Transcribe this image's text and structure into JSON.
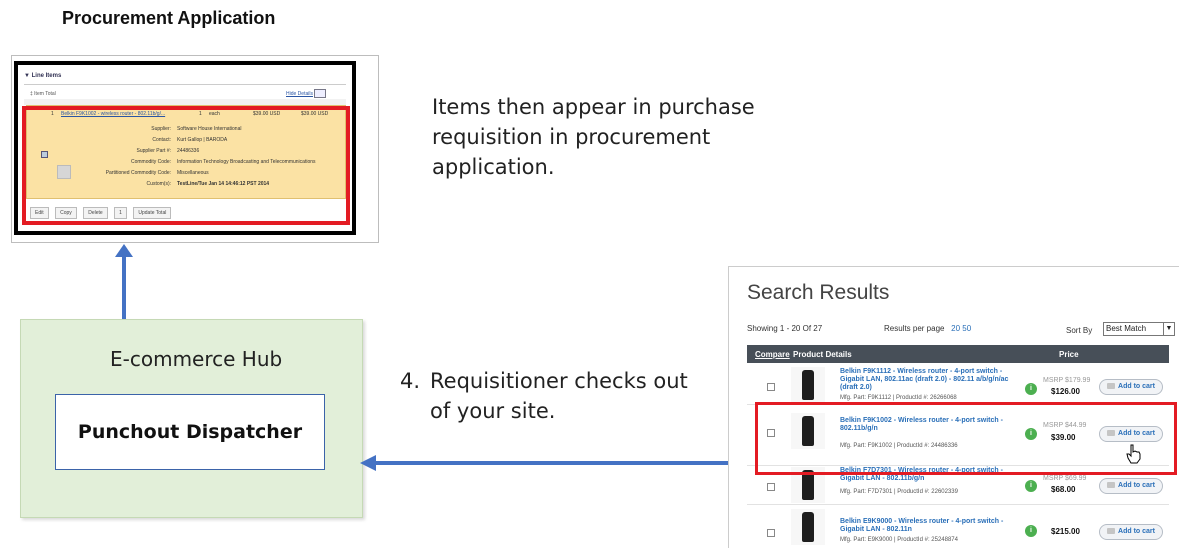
{
  "procurement": {
    "title": "Procurement Application",
    "panel_header": "▼ Line Items",
    "item_total": "‡ Item Total",
    "hide_details": "Hide Details",
    "line_number": "1",
    "product_link": "Belkin F9K1002 - wireless router - 802.11b/g/...",
    "qty": "1",
    "unit": "each",
    "unit_price": "$39.00 USD",
    "ext_price": "$39.00 USD",
    "details": [
      {
        "label": "Supplier:",
        "value": "Software House International"
      },
      {
        "label": "Contact:",
        "value": "Kurt Gallop | BARODA"
      },
      {
        "label": "Supplier Part #:",
        "value": "24486336"
      },
      {
        "label": "Commodity Code:",
        "value": "Information Technology Broadcasting and Telecommunications"
      },
      {
        "label": "Partitioned Commodity Code:",
        "value": "Miscellaneous"
      },
      {
        "label": "Custom(s):",
        "value": "TestLine/Tue Jan 14 14:46:12 PST 2014"
      }
    ],
    "buttons": [
      "Edit",
      "Copy",
      "Delete",
      "1",
      "Update Total"
    ]
  },
  "captions": {
    "step_items": "Items then appear in purchase requisition in procurement application.",
    "step4_num": "4.",
    "step4_line1": "Requisitioner checks out",
    "step4_line2": "of your site."
  },
  "hub": {
    "title": "E-commerce Hub",
    "dispatcher": "Punchout Dispatcher"
  },
  "search": {
    "title": "Search Results",
    "showing": "Showing 1 - 20 Of 27",
    "results_per_page_label": "Results per page",
    "per_page_options": "20 50",
    "sort_by_label": "Sort By",
    "sort_value": "Best Match",
    "col_compare": "Compare",
    "col_product": "Product Details",
    "col_price": "Price",
    "add_to_cart": "Add to cart",
    "rows": [
      {
        "name": "Belkin F9K1112 - Wireless router - 4-port switch - Gigabit LAN, 802.11ac (draft 2.0) - 802.11 a/b/g/n/ac (draft 2.0)",
        "mfg": "Mfg. Part: F9K1112 | ProductId #: 26266068",
        "msrp": "MSRP $179.99",
        "price": "$126.00"
      },
      {
        "name": "Belkin F9K1002 - Wireless router - 4-port switch - 802.11b/g/n",
        "mfg": "Mfg. Part: F9K1002 | ProductId #: 24486336",
        "msrp": "MSRP $44.99",
        "price": "$39.00"
      },
      {
        "name": "Belkin F7D7301 - Wireless router - 4-port switch - Gigabit LAN - 802.11b/g/n",
        "mfg": "Mfg. Part: F7D7301 | ProductId #: 22602339",
        "msrp": "MSRP $69.99",
        "price": "$68.00"
      },
      {
        "name": "Belkin E9K9000 - Wireless router - 4-port switch - Gigabit LAN - 802.11n",
        "mfg": "Mfg. Part: E9K9000 | ProductId #: 25248874",
        "msrp": "",
        "price": "$215.00"
      }
    ]
  },
  "colors": {
    "highlight": "#e31b23",
    "arrow": "#4472c4",
    "hub_bg": "#e2efd9",
    "requisition_bg": "#fbe2a4"
  }
}
